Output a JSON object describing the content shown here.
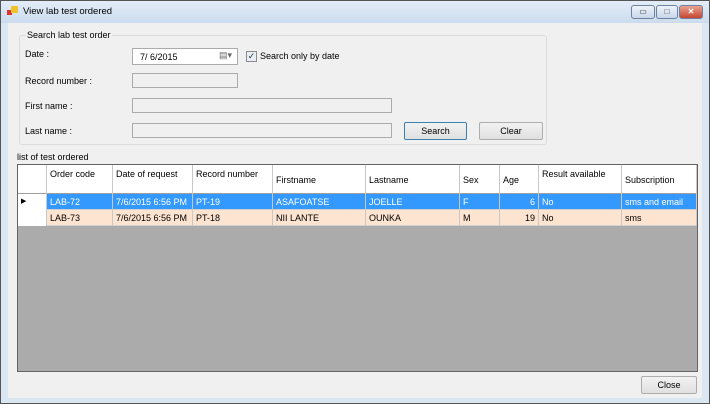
{
  "window": {
    "title": "View lab test ordered",
    "minimize": "▭",
    "maximize": "□",
    "close": "✕"
  },
  "search": {
    "group_title": "Search lab test order",
    "date_label": "Date :",
    "date_value": "7/  6/2015",
    "only_by_date_label": "Search only by date",
    "only_by_date_checked": true,
    "record_label": "Record number :",
    "record_value": "",
    "first_label": "First name :",
    "first_value": "",
    "last_label": "Last name :",
    "last_value": "",
    "search_button": "Search",
    "clear_button": "Clear"
  },
  "list": {
    "title": "list of test ordered",
    "columns": [
      "Order code",
      "Date of request",
      "Record number",
      "Firstname",
      "Lastname",
      "Sex",
      "Age",
      "Result available",
      "Subscription"
    ],
    "rows": [
      [
        "LAB-72",
        "7/6/2015 6:56 PM",
        "PT-19",
        "ASAFOATSE",
        "JOELLE",
        "F",
        "6",
        "No",
        "sms and email"
      ],
      [
        "LAB-73",
        "7/6/2015 6:56 PM",
        "PT-18",
        "NII LANTE",
        "OUNKA",
        "M",
        "19",
        "No",
        "sms"
      ]
    ],
    "colors": {
      "selected": "#3399ff",
      "alt": "#fde4d0"
    }
  },
  "close_button": "Close"
}
